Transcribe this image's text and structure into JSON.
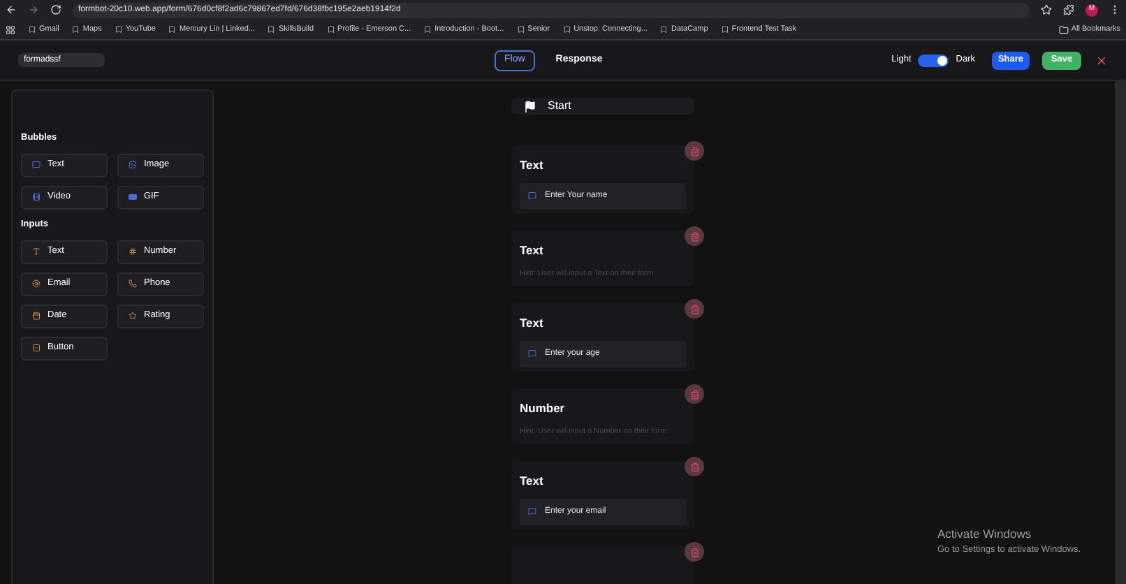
{
  "browser": {
    "url": "formbot-20c10.web.app/form/676d0cf8f2ad6c79867ed7fd/676d38fbc195e2aeb1914f2d",
    "bookmarks": [
      {
        "label": "Gmail"
      },
      {
        "label": "Maps"
      },
      {
        "label": "YouTube"
      },
      {
        "label": "Mercury Lin | Linked..."
      },
      {
        "label": "SkillsBuild"
      },
      {
        "label": "Profile - Emerson C..."
      },
      {
        "label": "Introduction - Boot..."
      },
      {
        "label": "Senior"
      },
      {
        "label": "Unstop: Connecting..."
      },
      {
        "label": "DataCamp"
      },
      {
        "label": "Frontend Test Task"
      }
    ],
    "all_bookmarks": "All Bookmarks",
    "profile_initial": "M"
  },
  "header": {
    "form_name": "formadssf",
    "tabs": [
      {
        "label": "Flow",
        "selected": true
      },
      {
        "label": "Response",
        "selected": false
      }
    ],
    "theme": {
      "light_label": "Light",
      "dark_label": "Dark",
      "on": true
    },
    "share": "Share",
    "save": "Save"
  },
  "sidebar": {
    "sections": [
      {
        "title": "Bubbles",
        "items": [
          {
            "label": "Text"
          },
          {
            "label": "Image"
          },
          {
            "label": "Video"
          },
          {
            "label": "GIF"
          }
        ]
      },
      {
        "title": "Inputs",
        "items": [
          {
            "label": "Text"
          },
          {
            "label": "Number"
          },
          {
            "label": "Email"
          },
          {
            "label": "Phone"
          },
          {
            "label": "Date"
          },
          {
            "label": "Rating"
          },
          {
            "label": "Button"
          }
        ]
      }
    ]
  },
  "flow": {
    "start": "Start",
    "cards": [
      {
        "title": "Text",
        "kind": "bubble",
        "text": "Enter Your name"
      },
      {
        "title": "Text",
        "kind": "hint",
        "text": "Hint: User will input a Text on their form"
      },
      {
        "title": "Text",
        "kind": "bubble",
        "text": "Enter your age"
      },
      {
        "title": "Number",
        "kind": "hint",
        "text": "Hint: User will input a Number on their form"
      },
      {
        "title": "Text",
        "kind": "bubble",
        "text": "Enter your email"
      }
    ]
  },
  "os_notice": {
    "title": "Activate Windows",
    "subtitle": "Go to Settings to activate Windows."
  }
}
